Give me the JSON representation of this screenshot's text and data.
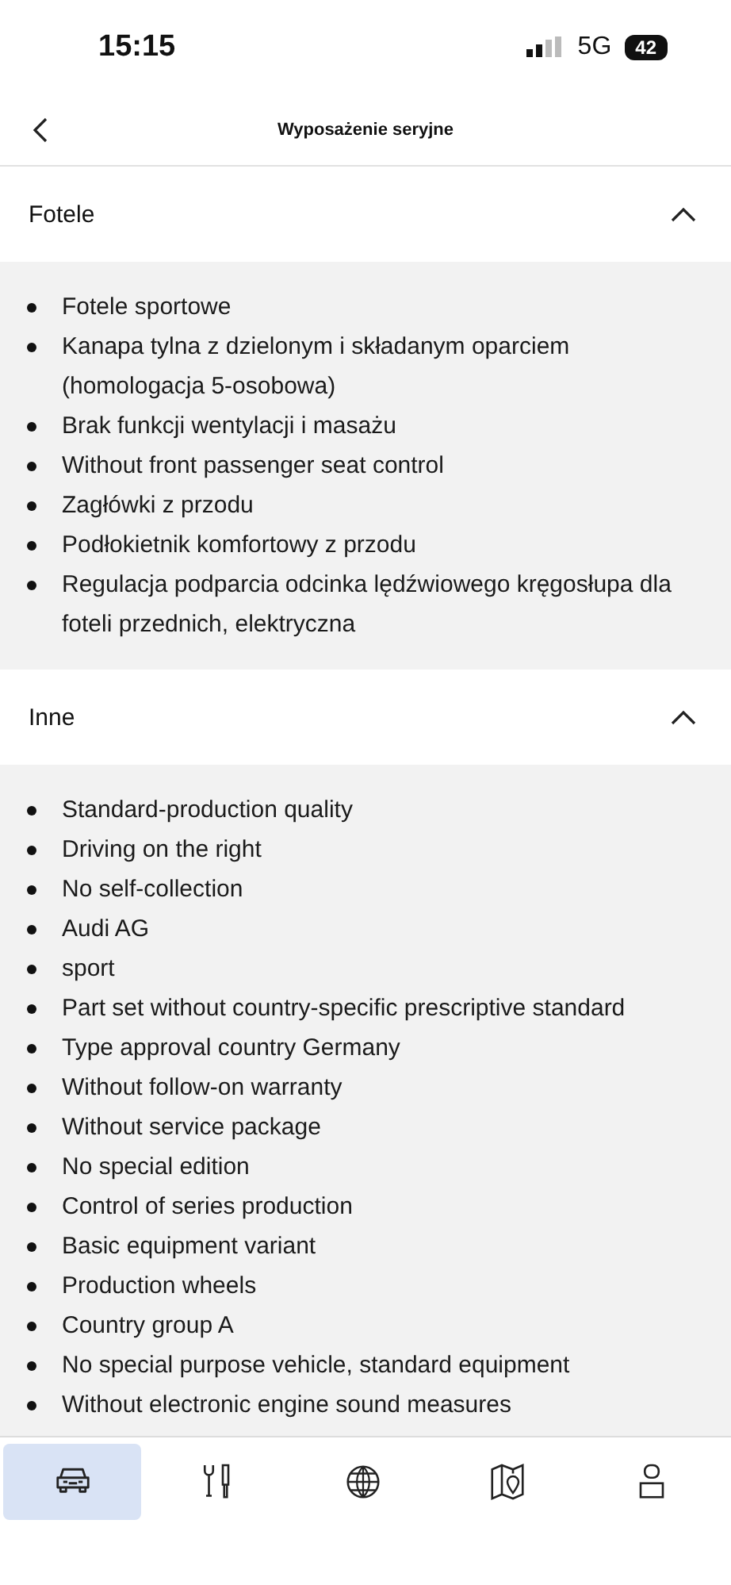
{
  "status_bar": {
    "time": "15:15",
    "network": "5G",
    "battery": "42"
  },
  "header": {
    "title": "Wyposażenie seryjne"
  },
  "sections": [
    {
      "title": "Fotele",
      "expanded": true,
      "items": [
        "Fotele sportowe",
        "Kanapa tylna z dzielonym i składanym oparciem (homologacja 5-osobowa)",
        "Brak funkcji wentylacji i masażu",
        "Without front passenger seat control",
        "Zagłówki z przodu",
        "Podłokietnik komfortowy z przodu",
        "Regulacja podparcia odcinka lędźwiowego kręgosłupa dla foteli przednich, elektryczna"
      ]
    },
    {
      "title": "Inne",
      "expanded": true,
      "items": [
        "Standard-production quality",
        "Driving on the right",
        "No self-collection",
        "Audi AG",
        "sport",
        "Part set without country-specific prescriptive standard",
        "Type approval country Germany",
        "Without follow-on warranty",
        "Without service package",
        "No special edition",
        "Control of series production",
        "Basic equipment variant",
        "Production wheels",
        "Country group A",
        "No special purpose vehicle, standard equipment",
        "Without electronic engine sound measures"
      ]
    }
  ],
  "tab_bar": [
    {
      "kind": "car",
      "selected": true
    },
    {
      "kind": "tools",
      "selected": false
    },
    {
      "kind": "globe",
      "selected": false
    },
    {
      "kind": "map",
      "selected": false
    },
    {
      "kind": "profile",
      "selected": false
    }
  ]
}
